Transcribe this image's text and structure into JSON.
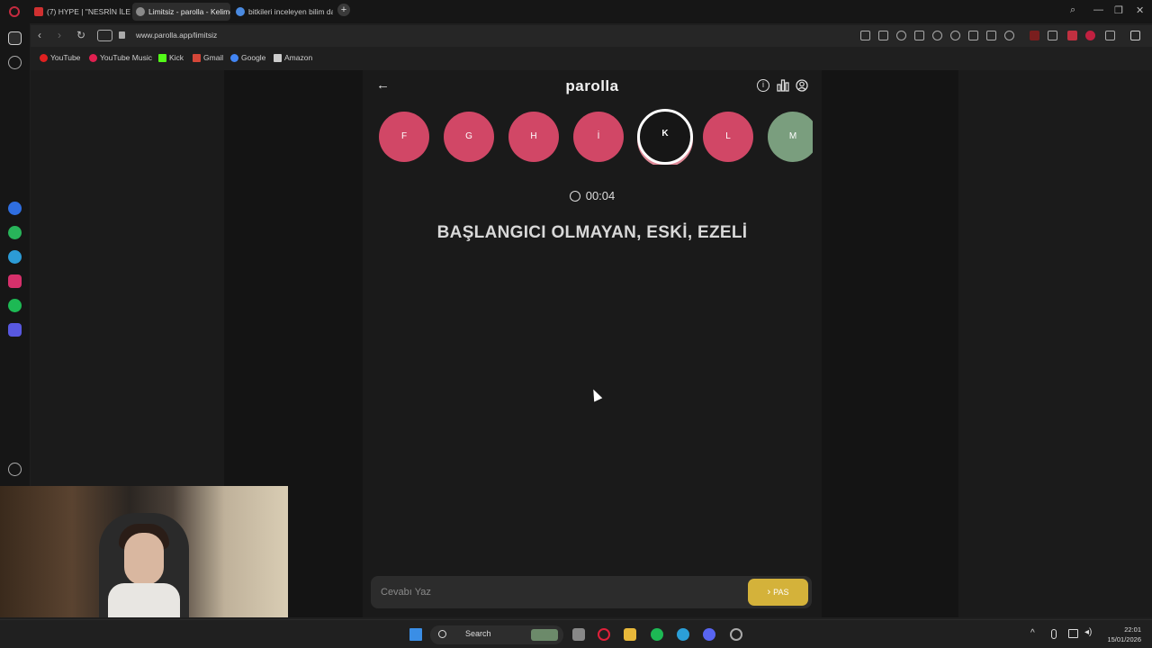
{
  "browser": {
    "tabs": [
      {
        "label": "(7) HYPE | \"NESRİN İLE PA",
        "color": "#d03030"
      },
      {
        "label": "Limitsiz - parolla - Kelime",
        "color": "#8a8a8a"
      },
      {
        "label": "bitkileri inceleyen bilim da",
        "color": "#4a8ae0"
      }
    ],
    "new_tab": "+",
    "url": "www.parolla.app/limitsiz",
    "bookmarks": [
      {
        "label": "YouTube",
        "color": "#e02020"
      },
      {
        "label": "YouTube Music",
        "color": "#e02050"
      },
      {
        "label": "Kick",
        "color": "#53fc18"
      },
      {
        "label": "Gmail",
        "color": "#d44638"
      },
      {
        "label": "Google",
        "color": "#4285f4"
      },
      {
        "label": "Amazon",
        "color": "#cccccc"
      }
    ]
  },
  "game": {
    "logo": "parolla",
    "back_icon": "arrow-left-icon",
    "letters": [
      {
        "letter": "F",
        "state": "wrong"
      },
      {
        "letter": "G",
        "state": "wrong"
      },
      {
        "letter": "H",
        "state": "wrong"
      },
      {
        "letter": "İ",
        "state": "wrong"
      },
      {
        "letter": "K",
        "state": "current"
      },
      {
        "letter": "L",
        "state": "wrong"
      },
      {
        "letter": "M",
        "state": "correct"
      }
    ],
    "timer": "00:04",
    "question": "BAŞLANGICI OLMAYAN, ESKİ, EZELİ",
    "answer_placeholder": "Cevabı Yaz",
    "pass_label": "PAS",
    "pass_arrow": "›"
  },
  "colors": {
    "wrong": "#d14766",
    "correct": "#7a9e7e",
    "pass_button": "#d4b23a"
  },
  "taskbar": {
    "search_label": "Search",
    "time": "22:01",
    "date": "15/01/2026"
  }
}
